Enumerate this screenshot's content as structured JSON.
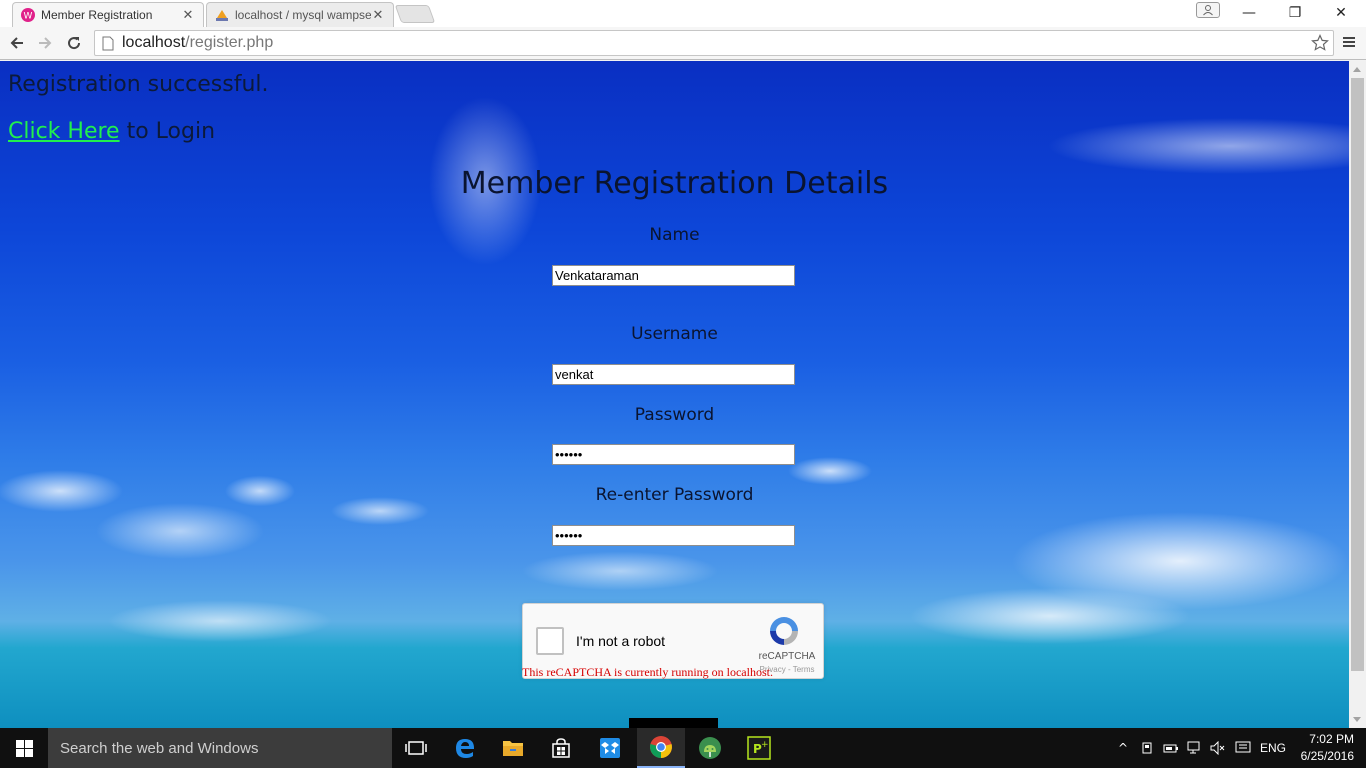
{
  "browser": {
    "tabs": [
      {
        "title": "Member Registration",
        "active": true
      },
      {
        "title": "localhost / mysql wampse",
        "active": false
      }
    ],
    "url": {
      "host": "localhost",
      "path": "/register.php"
    }
  },
  "page": {
    "status_message": "Registration successful.",
    "login_link_text": "Click Here",
    "login_suffix": " to Login",
    "form_title": "Member Registration Details",
    "fields": {
      "name": {
        "label": "Name",
        "value": "Venkataraman"
      },
      "username": {
        "label": "Username",
        "value": "venkat"
      },
      "password": {
        "label": "Password",
        "value": "••••••"
      },
      "repassword": {
        "label": "Re-enter Password",
        "value": "••••••"
      }
    },
    "recaptcha": {
      "checkbox_label": "I'm not a robot",
      "brand": "reCAPTCHA",
      "terms": "Privacy - Terms",
      "warning": "This reCAPTCHA is currently running on localhost."
    }
  },
  "taskbar": {
    "search_placeholder": "Search the web and Windows",
    "language": "ENG",
    "time": "7:02 PM",
    "date": "6/25/2016"
  },
  "colors": {
    "link": "#21f04d",
    "warning": "#d60000",
    "sky_top": "#0a2fc2",
    "taskbar": "#101010"
  }
}
